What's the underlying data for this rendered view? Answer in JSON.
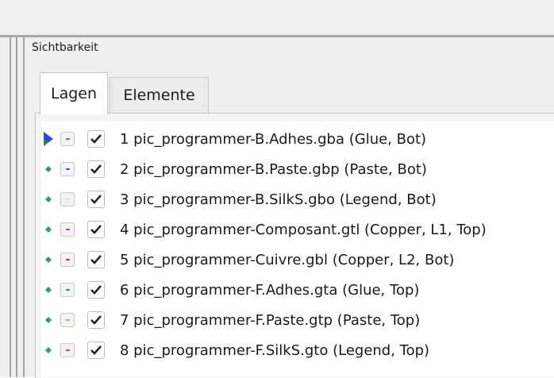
{
  "panel": {
    "title": "Sichtbarkeit"
  },
  "tabs": [
    {
      "label": "Lagen",
      "active": true
    },
    {
      "label": "Elemente",
      "active": false
    }
  ],
  "colors": {
    "marker_active": "#1f4fe0",
    "marker_active_green": "#2a8f2a",
    "marker_inactive": "#2f9e74"
  },
  "layers": [
    {
      "label": "1 pic_programmer-B.Adhes.gba (Glue, Bot)",
      "checked": true,
      "active": true,
      "dot": "#2e8b57"
    },
    {
      "label": "2 pic_programmer-B.Paste.gbp (Paste, Bot)",
      "checked": true,
      "active": false,
      "dot": "#3f4fa8"
    },
    {
      "label": "3 pic_programmer-B.SilkS.gbo (Legend, Bot)",
      "checked": true,
      "active": false,
      "dot": "#d9d9d9"
    },
    {
      "label": "4 pic_programmer-Composant.gtl (Copper, L1, Top)",
      "checked": true,
      "active": false,
      "dot": "#b23a8c"
    },
    {
      "label": "5 pic_programmer-Cuivre.gbl (Copper, L2, Bot)",
      "checked": true,
      "active": false,
      "dot": "#c0392b"
    },
    {
      "label": "6 pic_programmer-F.Adhes.gta (Glue, Top)",
      "checked": true,
      "active": false,
      "dot": "#2e8b57"
    },
    {
      "label": "7 pic_programmer-F.Paste.gtp (Paste, Top)",
      "checked": true,
      "active": false,
      "dot": "#b5a642"
    },
    {
      "label": "8 pic_programmer-F.SilkS.gto (Legend, Top)",
      "checked": true,
      "active": false,
      "dot": "#b23a8c"
    }
  ]
}
